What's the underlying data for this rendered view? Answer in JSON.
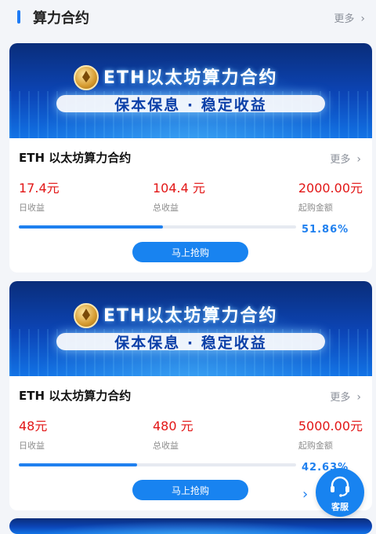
{
  "header": {
    "title": "算力合约",
    "more_label": "更多"
  },
  "products": [
    {
      "banner_line1": "ETH以太坊算力合约",
      "banner_line2": "保本保息 · 稳定收益",
      "name": "ETH 以太坊算力合约",
      "more_label": "更多",
      "daily_income": "17.4元",
      "daily_income_label": "日收益",
      "total_income": "104.4 元",
      "total_income_label": "总收益",
      "min_purchase": "2000.00元",
      "min_purchase_label": "起购金额",
      "progress_percent": 51.86,
      "progress_text": "51.86%",
      "buy_label": "马上抢购"
    },
    {
      "banner_line1": "ETH以太坊算力合约",
      "banner_line2": "保本保息 · 稳定收益",
      "name": "ETH 以太坊算力合约",
      "more_label": "更多",
      "daily_income": "48元",
      "daily_income_label": "日收益",
      "total_income": "480 元",
      "total_income_label": "总收益",
      "min_purchase": "5000.00元",
      "min_purchase_label": "起购金额",
      "progress_percent": 42.63,
      "progress_text": "42.63%",
      "buy_label": "马上抢购"
    }
  ],
  "customer_service": {
    "label": "客服",
    "icon": "headset-icon"
  },
  "colors": {
    "accent": "#1883f0",
    "price": "#e21616",
    "background": "#f3f5f9"
  }
}
